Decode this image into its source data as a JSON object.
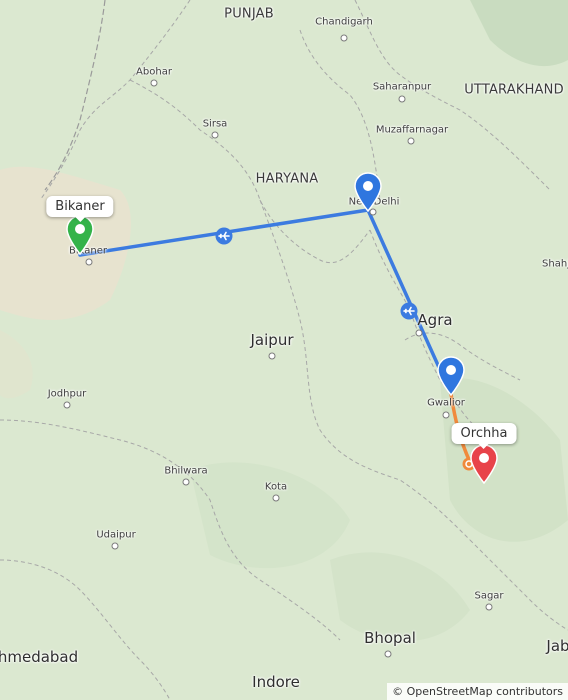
{
  "map": {
    "states": [
      "PUNJAB",
      "HARYANA",
      "UTTARAKHAND"
    ],
    "cities": {
      "chandigarh": "Chandigarh",
      "abohar": "Abohar",
      "saharanpur": "Saharanpur",
      "sirsa": "Sirsa",
      "muzaffarnagar": "Muzaffarnagar",
      "new_delhi": "New Delhi",
      "bikaner": "Bikaner",
      "shahj": "Shahj",
      "agra": "Agra",
      "jaipur": "Jaipur",
      "jodhpur": "Jodhpur",
      "gwalior": "Gwalior",
      "bhilwara": "Bhilwara",
      "kota": "Kota",
      "udaipur": "Udaipur",
      "sagar": "Sagar",
      "bhopal": "Bhopal",
      "ahmedabad": "hmedabad",
      "jab": "Jab",
      "indore": "Indore"
    }
  },
  "route": {
    "start": "Bikaner",
    "end": "Orchha",
    "legs": [
      {
        "from": "Bikaner",
        "to": "New Delhi",
        "mode": "flight",
        "color": "#3c7be0"
      },
      {
        "from": "New Delhi",
        "to": "Gwalior",
        "mode": "flight",
        "color": "#3c7be0"
      },
      {
        "from": "Gwalior",
        "to": "Orchha",
        "mode": "road",
        "color": "#f08a3c"
      }
    ],
    "start_color": "#34b34a",
    "stop_color": "#2f76df",
    "end_color": "#e8434a"
  },
  "attribution": "© OpenStreetMap contributors"
}
